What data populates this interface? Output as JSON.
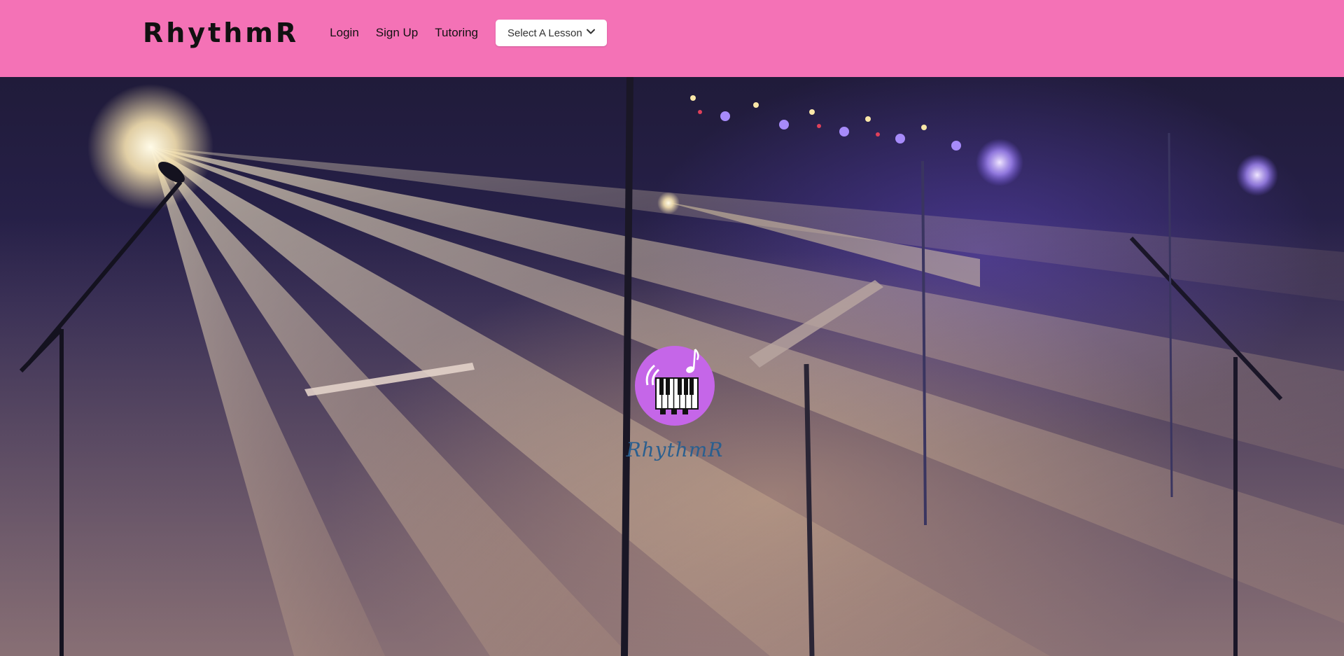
{
  "navbar": {
    "brand": "RhythmR",
    "links": [
      "Login",
      "Sign Up",
      "Tutoring"
    ],
    "lesson_select": {
      "label": "Select A Lesson",
      "icon": "chevron-down-icon"
    },
    "background_color": "#f472b6"
  },
  "hero": {
    "logo": {
      "text": "RhythmR",
      "icon": "piano-music-note-icon",
      "circle_color": "#c566e8",
      "text_color": "#2a5f8f"
    }
  }
}
